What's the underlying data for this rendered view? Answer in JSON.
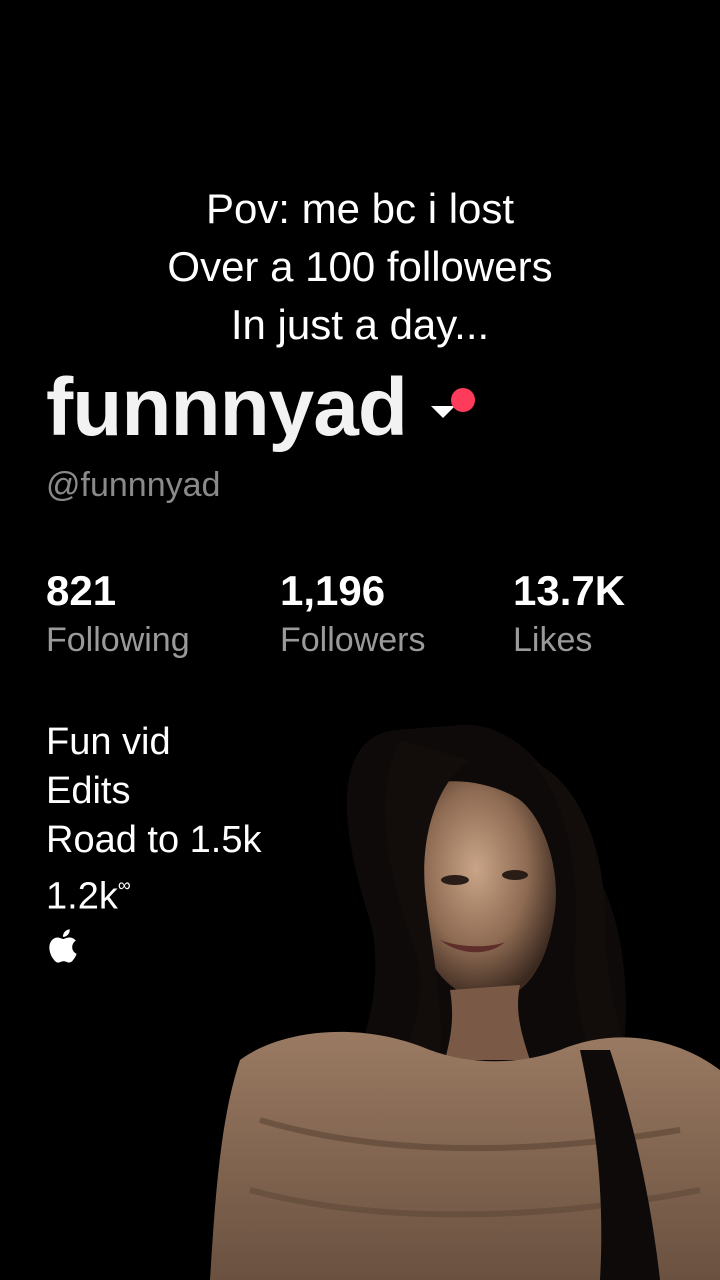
{
  "caption": {
    "line1": "Pov: me bc i lost",
    "line2": "Over a 100 followers",
    "line3": "In just a day..."
  },
  "profile": {
    "display_name": "funnnyad",
    "handle": "@funnnyad",
    "switch_icon": "chevron-down-icon",
    "notification_dot_color": "#ff3b5c"
  },
  "stats": [
    {
      "value": "821",
      "label": "Following"
    },
    {
      "value": "1,196",
      "label": "Followers"
    },
    {
      "value": "13.7K",
      "label": "Likes"
    }
  ],
  "bio": {
    "line1": "Fun vid",
    "line2": "Edits",
    "line3": "Road to 1.5k",
    "line4": "1.2k",
    "line4_sup": "∞",
    "icon": "apple-icon"
  },
  "overlay_image": "woman-cutout"
}
